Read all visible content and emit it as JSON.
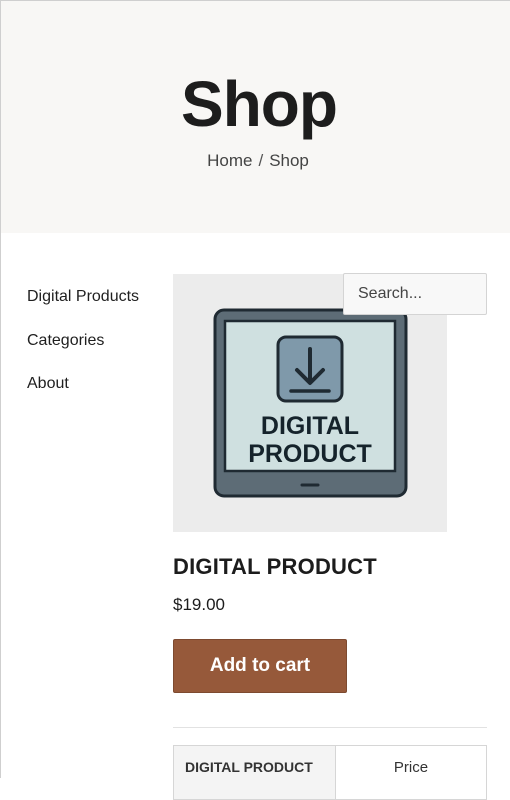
{
  "hero": {
    "title": "Shop",
    "breadcrumb": {
      "home": "Home",
      "separator": "/",
      "current": "Shop"
    }
  },
  "sidebar": {
    "items": [
      {
        "label": "Digital Products"
      },
      {
        "label": "Categories"
      },
      {
        "label": "About"
      }
    ]
  },
  "search": {
    "placeholder": "Search..."
  },
  "product": {
    "image_text_line1": "DIGITAL",
    "image_text_line2": "PRODUCT",
    "image_icon": "download-icon",
    "title": "DIGITAL PRODUCT",
    "price": "$19.00",
    "add_to_cart_label": "Add to cart"
  },
  "table": {
    "name_cell": "DIGITAL PRODUCT",
    "price_header": "Price"
  },
  "colors": {
    "accent": "#96593a",
    "hero_bg": "#f8f7f5",
    "image_bg": "#ececec",
    "tablet_frame": "#5d6c76",
    "tablet_screen": "#cfe0e0"
  }
}
